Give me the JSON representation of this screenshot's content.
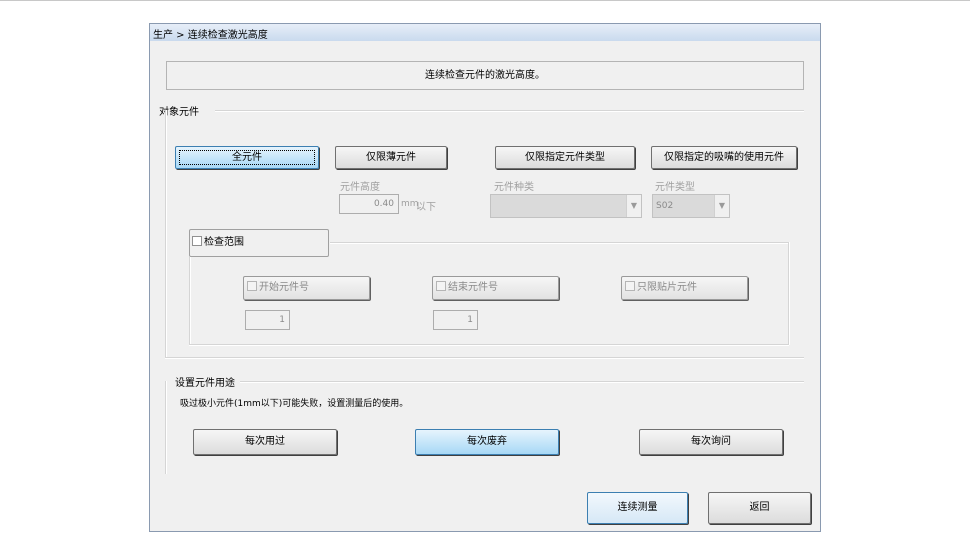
{
  "window": {
    "title": "生产 > 连续检查激光高度"
  },
  "info": {
    "text": "连续检查元件的激光高度。"
  },
  "target_group": {
    "label": "对象元件",
    "buttons": {
      "all": "全元件",
      "thin_only": "仅限薄元件",
      "type_only": "仅限指定元件类型",
      "nozzle_only": "仅限指定的吸嘴的使用元件"
    },
    "height": {
      "label": "元件高度",
      "value": "0.40",
      "unit": "mm",
      "suffix": "以下"
    },
    "kind": {
      "label": "元件种类",
      "value": ""
    },
    "type": {
      "label": "元件类型",
      "value": "S02"
    }
  },
  "range_group": {
    "checkbox_label": "检查范围",
    "start": {
      "label": "开始元件号",
      "value": "1"
    },
    "end": {
      "label": "结束元件号",
      "value": "1"
    },
    "mount_only": {
      "label": "只限贴片元件"
    }
  },
  "usage_group": {
    "label": "设置元件用途",
    "note": "吸过极小元件(1mm以下)可能失败，设置测量后的使用。",
    "buttons": {
      "each_use": "每次用过",
      "each_discard": "每次废弃",
      "each_ask": "每次询问"
    }
  },
  "footer": {
    "measure": "连续测量",
    "back": "返回"
  },
  "colors": {
    "selected_button": "#a7d8f6",
    "window_bg": "#f0f0f0",
    "title_bar": "#c9daee"
  }
}
